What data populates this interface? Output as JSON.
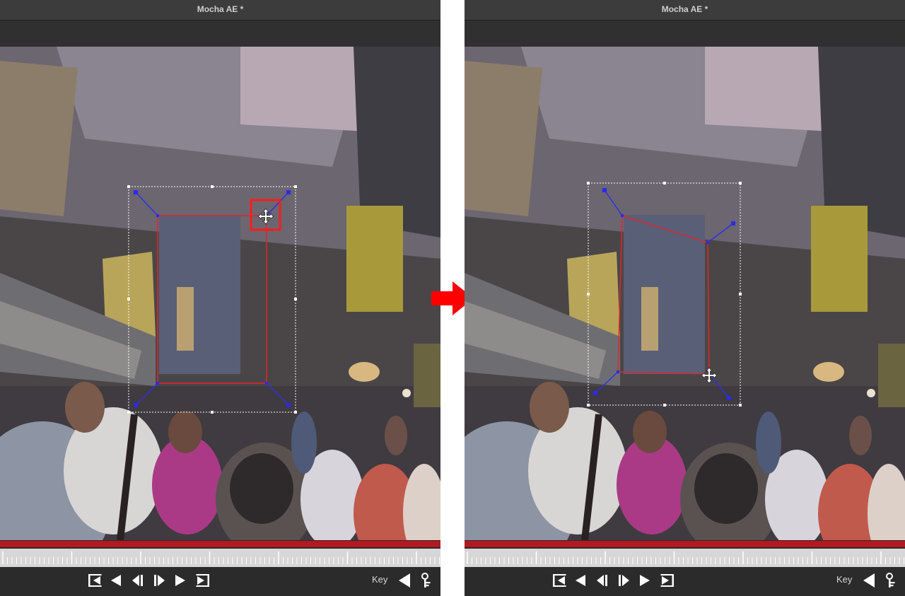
{
  "panels": [
    {
      "id": "before",
      "window_title": "Mocha AE *"
    },
    {
      "id": "after",
      "window_title": "Mocha AE *"
    }
  ],
  "playback_controls": [
    {
      "name": "go-to-start",
      "icon": "skip-to-start-icon"
    },
    {
      "name": "play-backward",
      "icon": "play-backward-icon"
    },
    {
      "name": "step-backward",
      "icon": "step-backward-icon"
    },
    {
      "name": "step-forward",
      "icon": "step-forward-icon"
    },
    {
      "name": "play-forward",
      "icon": "play-forward-icon"
    },
    {
      "name": "go-to-end",
      "icon": "skip-to-end-icon"
    }
  ],
  "key_controls": {
    "label": "Key",
    "add_key_icon": "key-triangle-icon",
    "adjust_icon": "key-adjust-icon"
  },
  "colors": {
    "surface_outline": "#e0262a",
    "tangent_handles": "#2f31e0",
    "handle_points": "#2a2af5",
    "bounding_box": "#ffffff",
    "timeline_bar": "#b41820",
    "highlight_box": "#ff1a1a",
    "transition_arrow": "#ff0000"
  },
  "annotations": {
    "highlighted_handle": "top-right corner handle (before)",
    "transition_arrow_icon": "right-arrow-icon",
    "cursor_icon": "move-cursor-icon"
  }
}
